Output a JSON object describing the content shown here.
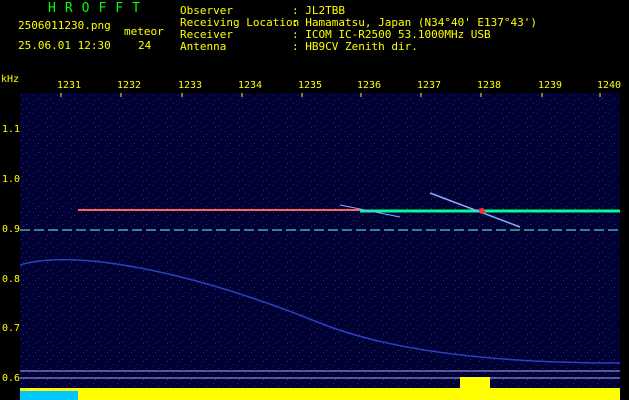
{
  "header": {
    "title": "HROFFT",
    "filename": "2506011230.png",
    "datetime": "25.06.01 12:30",
    "meteor_label": "meteor",
    "meteor_count": "24",
    "info": [
      {
        "label": "Observer",
        "value": ": JL2TBB"
      },
      {
        "label": "Receiving Location",
        "value": ": Hamamatsu, Japan (N34°40' E137°43')"
      },
      {
        "label": "Receiver",
        "value": ": ICOM IC-R2500 53.1000MHz USB"
      },
      {
        "label": "Antenna",
        "value": ": HB9CV Zenith dir."
      }
    ]
  },
  "axes": {
    "y_unit": "kHz",
    "x_ticks": [
      "1231",
      "1232",
      "1233",
      "1234",
      "1235",
      "1236",
      "1237",
      "1238",
      "1239",
      "1240"
    ],
    "y_ticks": [
      "1.1",
      "1.0",
      "0.9",
      "0.8",
      "0.7",
      "0.6"
    ]
  },
  "colors": {
    "text": "#ffff00",
    "title": "#00ff00",
    "background": "#000033",
    "signal": "#00ff80",
    "reference": "#ffff66"
  }
}
